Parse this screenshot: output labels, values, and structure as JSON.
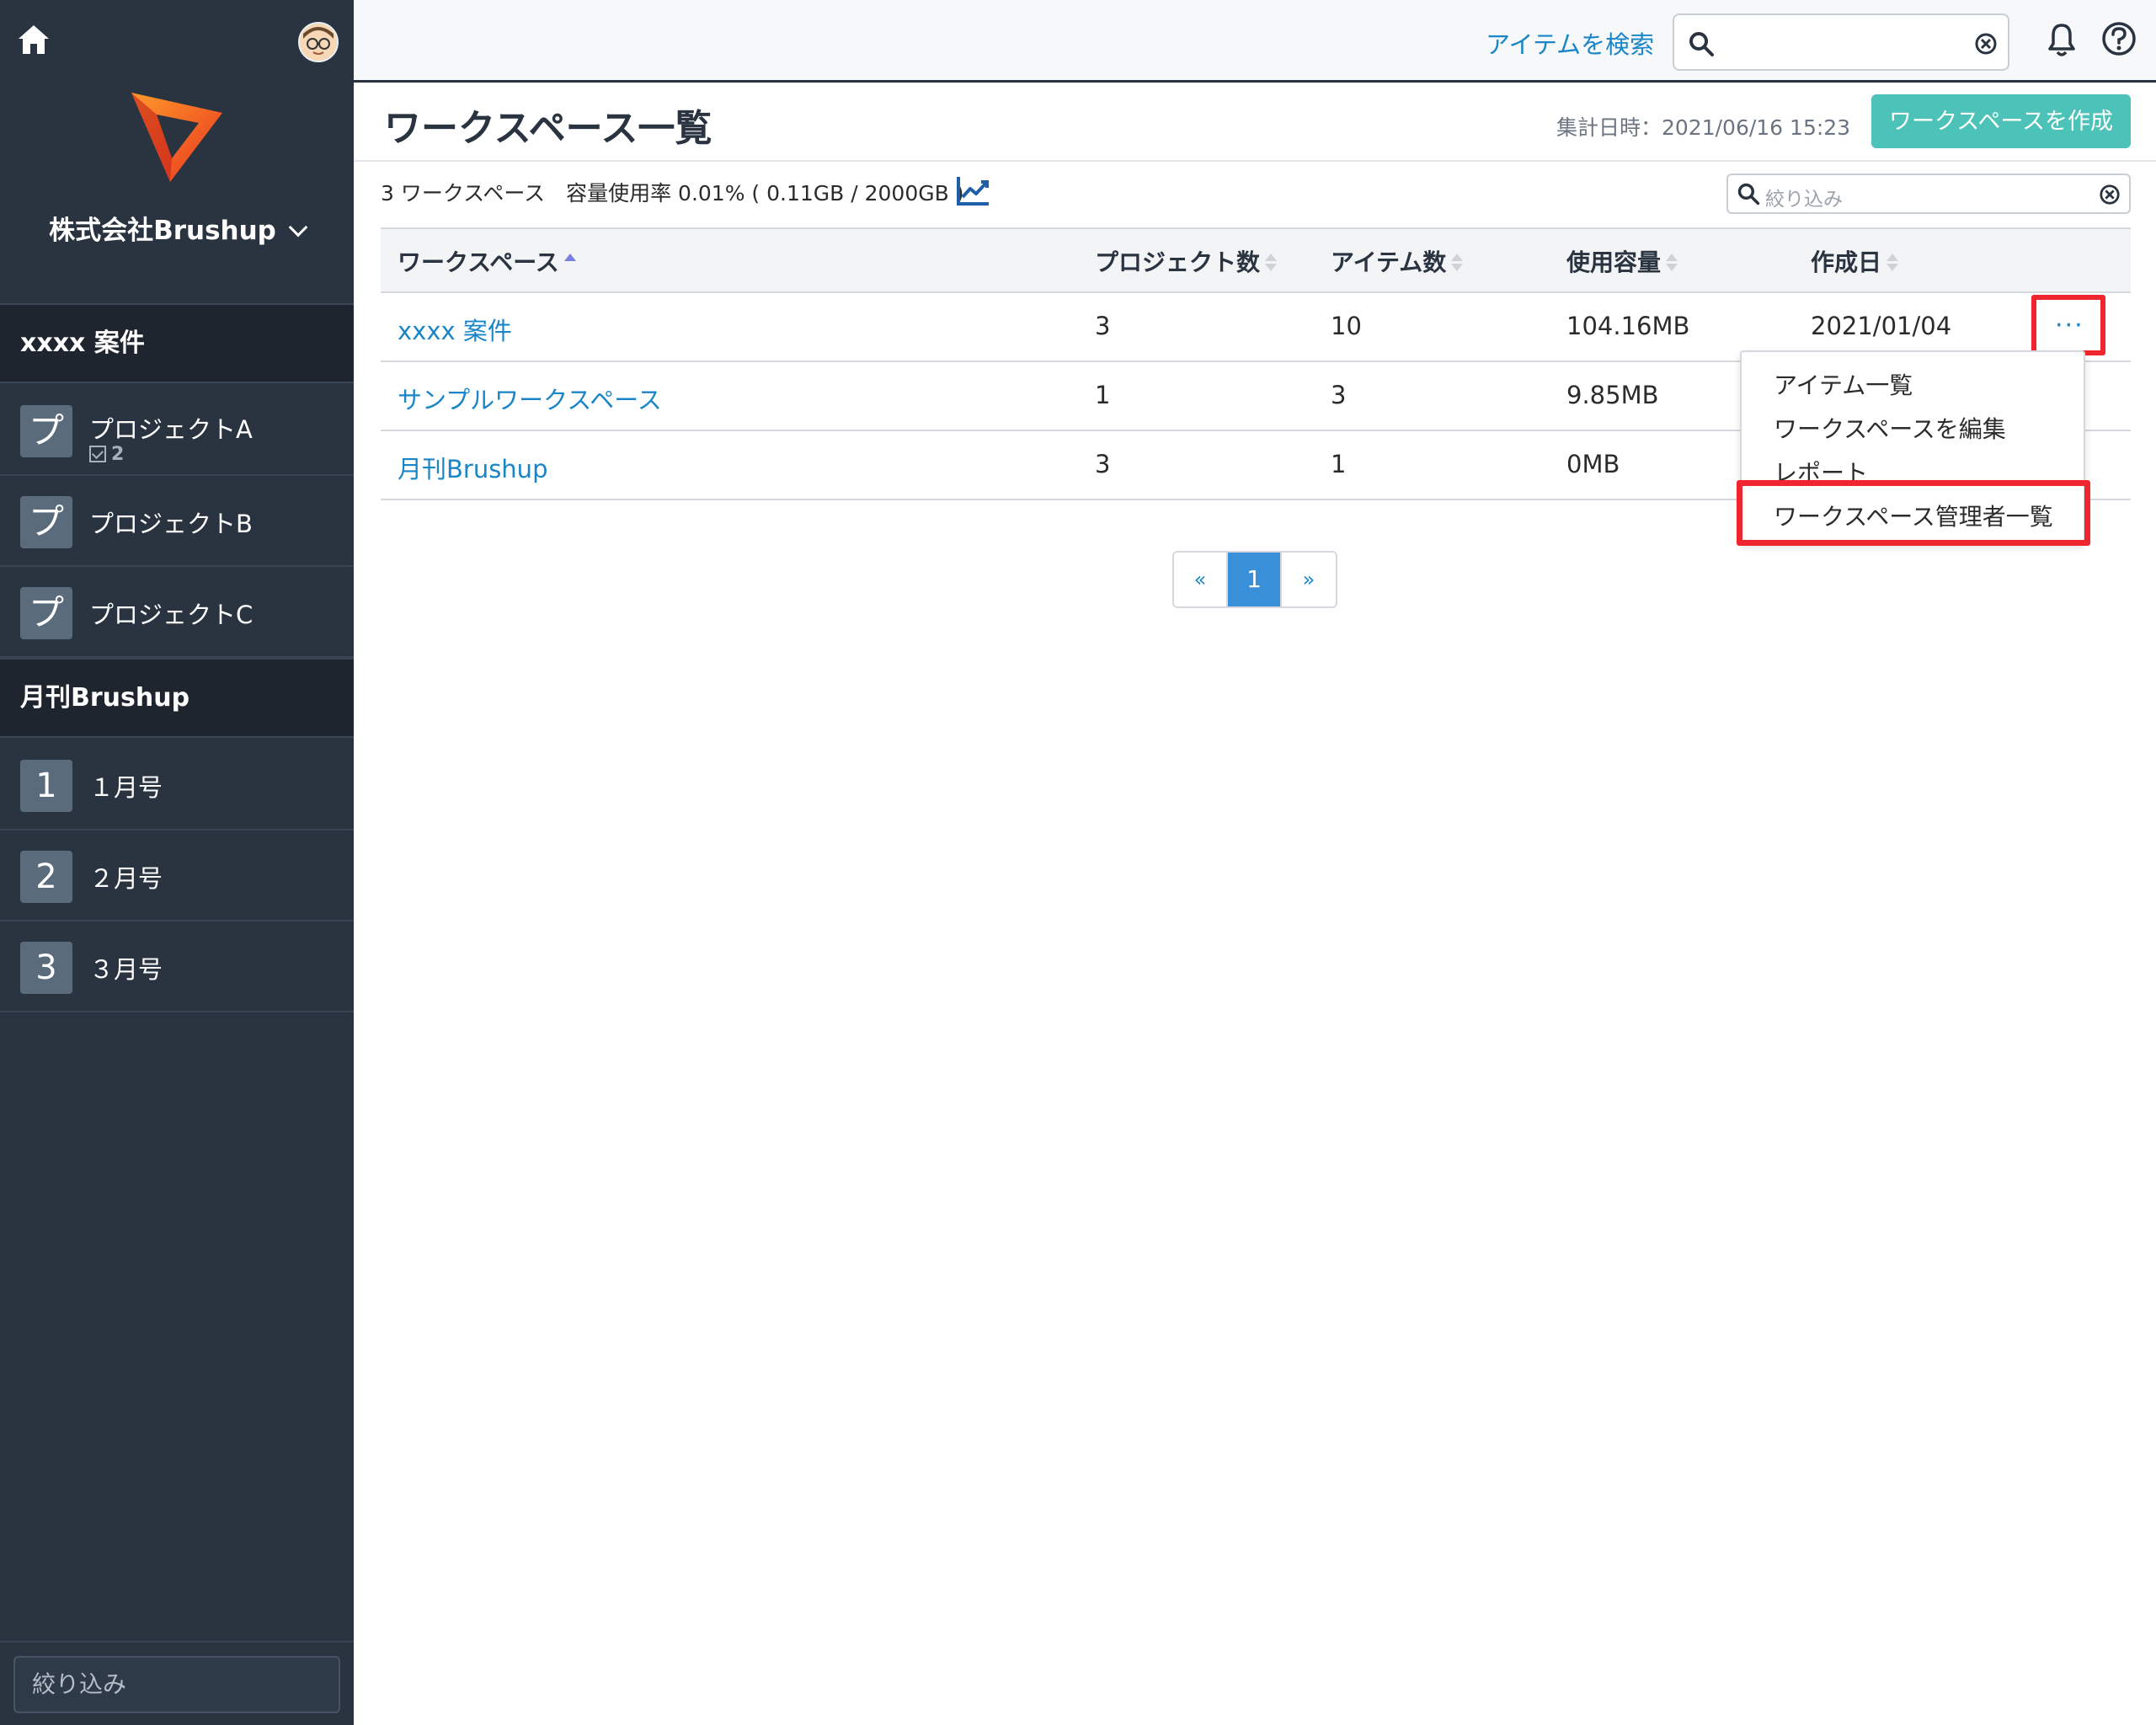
{
  "sidebar": {
    "company": "株式会社Brushup",
    "groups": [
      {
        "title": "xxxx 案件",
        "projects": [
          {
            "icon": "プ",
            "name": "プロジェクトA",
            "count": "2"
          },
          {
            "icon": "プ",
            "name": "プロジェクトB"
          },
          {
            "icon": "プ",
            "name": "プロジェクトC"
          }
        ]
      },
      {
        "title": "月刊Brushup",
        "projects": [
          {
            "icon": "1",
            "name": "１月号"
          },
          {
            "icon": "2",
            "name": "２月号"
          },
          {
            "icon": "3",
            "name": "３月号"
          }
        ]
      }
    ],
    "filter_placeholder": "絞り込み"
  },
  "topbar": {
    "search_label": "アイテムを検索",
    "search_value": ""
  },
  "page": {
    "title": "ワークスペース一覧",
    "aggregated": "集計日時：2021/06/16 15:23",
    "create_button": "ワークスペースを作成",
    "summary": "3 ワークスペース　容量使用率 0.01% ( 0.11GB / 2000GB )",
    "filter_placeholder": "絞り込み"
  },
  "table": {
    "columns": [
      "ワークスペース",
      "プロジェクト数",
      "アイテム数",
      "使用容量",
      "作成日"
    ],
    "rows": [
      {
        "name": "xxxx 案件",
        "projects": "3",
        "items": "10",
        "usage": "104.16MB",
        "created": "2021/01/04"
      },
      {
        "name": "サンプルワークスペース",
        "projects": "1",
        "items": "3",
        "usage": "9.85MB",
        "created": ""
      },
      {
        "name": "月刊Brushup",
        "projects": "3",
        "items": "1",
        "usage": "0MB",
        "created": ""
      }
    ]
  },
  "row_menu": {
    "more": "···",
    "items": [
      "アイテム一覧",
      "ワークスペースを編集",
      "レポート",
      "ワークスペース管理者一覧"
    ]
  },
  "pagination": {
    "prev": "«",
    "current": "1",
    "next": "»"
  },
  "colors": {
    "sidebar_bg": "#2a3441",
    "accent_link": "#1a86c8",
    "create_button": "#4dc2b8",
    "highlight": "#f0262e",
    "page_current": "#3a8fd9"
  }
}
